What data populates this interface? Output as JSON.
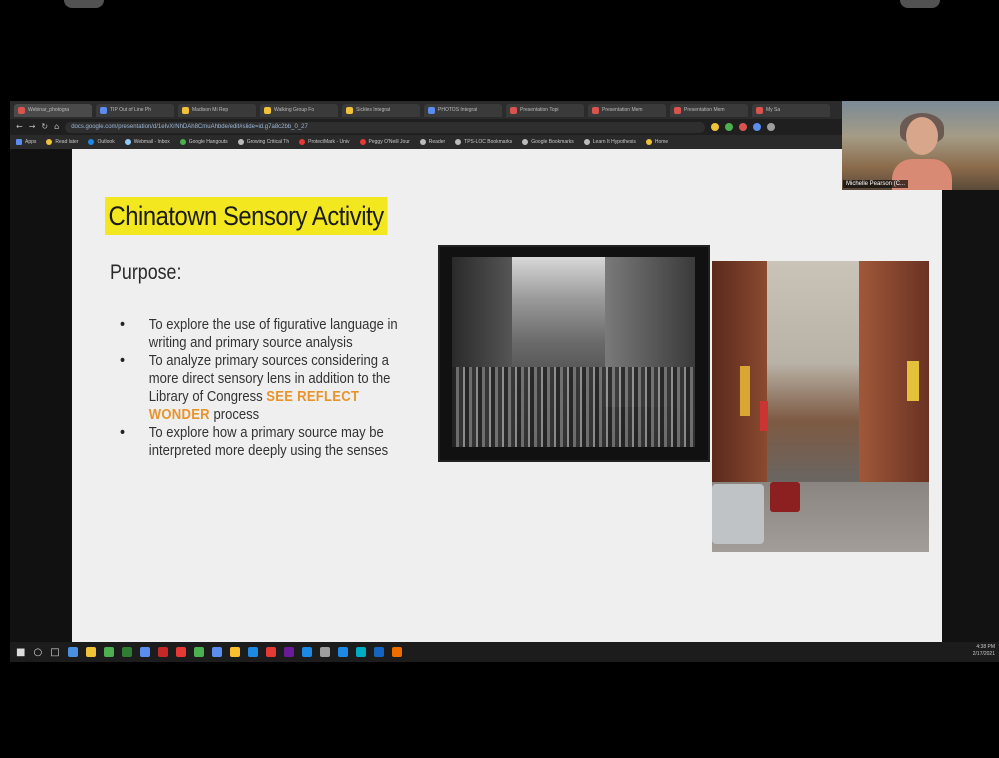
{
  "browser": {
    "tabs": [
      {
        "label": "Webinar_photogra",
        "color": "#d9534f"
      },
      {
        "label": "TIP Out of Line Ph",
        "color": "#5b8def"
      },
      {
        "label": "Madison Mi Rep",
        "color": "#f0c23a"
      },
      {
        "label": "Walking Group Fo",
        "color": "#f0c23a"
      },
      {
        "label": "Sickles Integrat",
        "color": "#f0c23a"
      },
      {
        "label": "PHOTOS Integrat",
        "color": "#5b8def"
      },
      {
        "label": "Presentation Topi",
        "color": "#d9534f"
      },
      {
        "label": "Presentation Mem",
        "color": "#d9534f"
      },
      {
        "label": "Presentation Mem",
        "color": "#d9534f"
      },
      {
        "label": "My Sa",
        "color": "#d9534f"
      }
    ],
    "url": "docs.google.com/presentation/d/1eIvXrNhDAh8CmuAhbde/edit#slide=id.g7a8c2bb_0_27",
    "bookmarks": [
      "Apps",
      "Read later",
      "Outlook",
      "Webmail - Inbox",
      "Google Hangouts",
      "Growing Critical Th",
      "ProtectMark - Univ",
      "Peggy O'Neill Jour",
      "Reader",
      "TPS-LOC Bookmarks",
      "Google Bookmarks",
      "Learn It Hypothesis",
      "Home"
    ]
  },
  "slide": {
    "title": "Chinatown Sensory Activity",
    "purpose_heading": "Purpose:",
    "bullets": [
      {
        "text": "To explore the use of figurative language in writing and primary source analysis"
      },
      {
        "pre": "To analyze primary sources considering a more direct sensory lens in addition to the Library of Congress ",
        "highlight": "SEE REFLECT WONDER",
        "post": " process"
      },
      {
        "text": "To explore how a primary source may be interpreted more deeply using the senses"
      }
    ],
    "accent_title_bg": "#f3e71f",
    "accent_highlight": "#e8942b"
  },
  "webcam": {
    "name": "Michelle Pearson (C..."
  },
  "taskbar": {
    "clock_time": "4:38 PM",
    "clock_date": "2/17/2021",
    "icons": [
      "#4a90e2",
      "#f0c23a",
      "#4caf50",
      "#2e7d32",
      "#5b8def",
      "#c62828",
      "#e53935",
      "#4caf50",
      "#5b8def",
      "#fbc02d",
      "#1e88e5",
      "#e53935",
      "#6a1b9a",
      "#1e88e5",
      "#9e9e9e",
      "#1e88e5",
      "#00acc1",
      "#1565c0",
      "#ef6c00"
    ]
  }
}
